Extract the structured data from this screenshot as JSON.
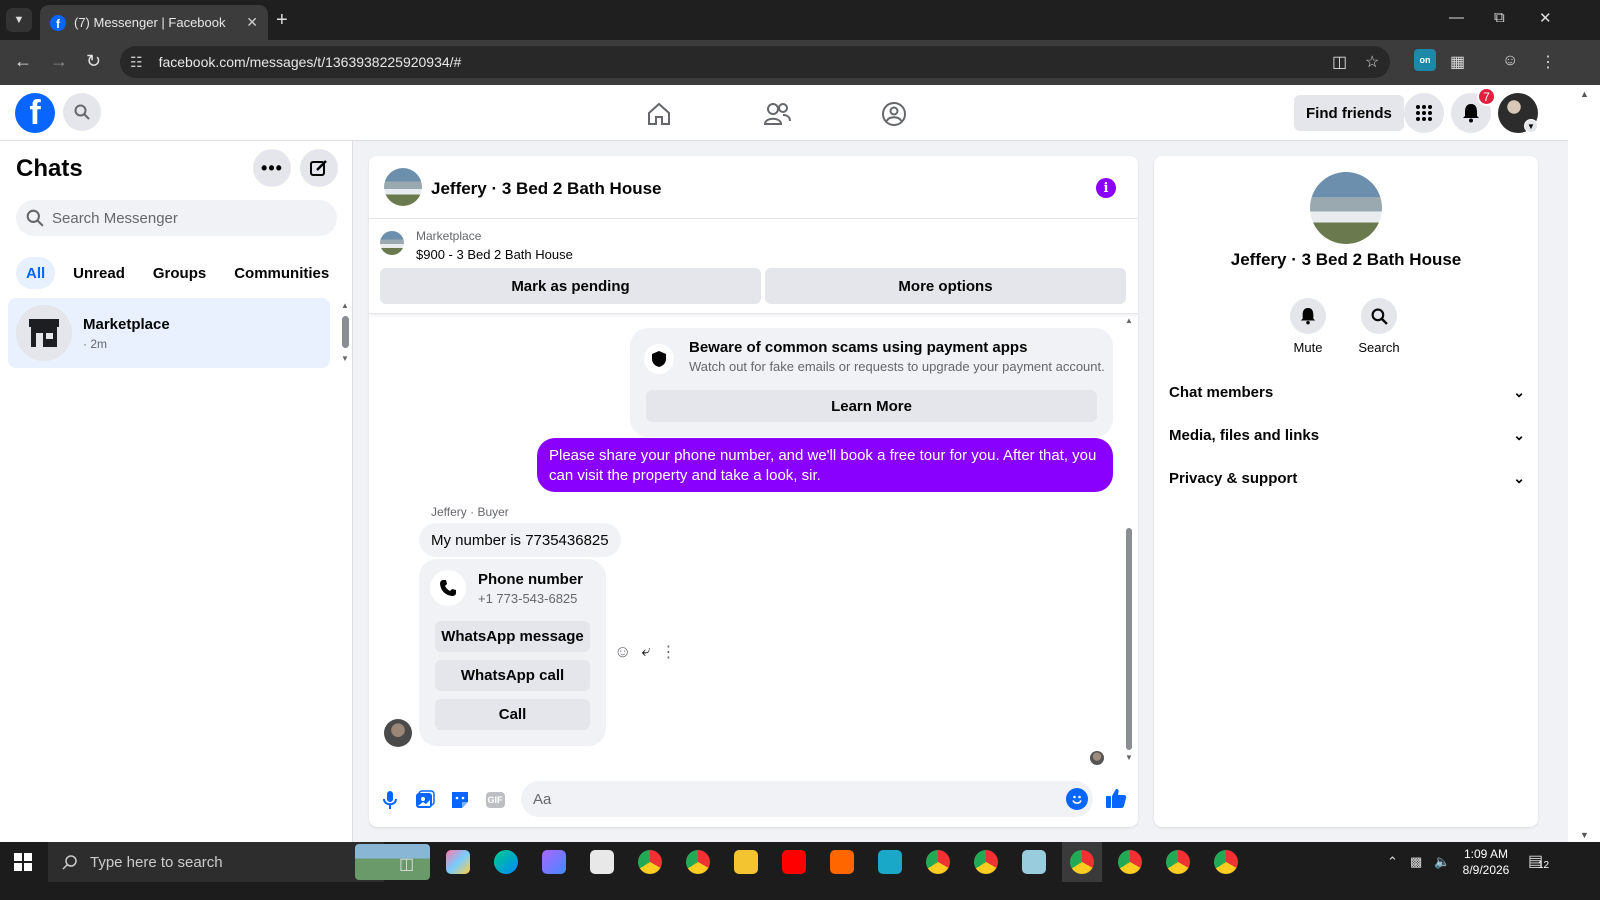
{
  "browser": {
    "tab_title": "(7) Messenger | Facebook",
    "url": "facebook.com/messages/t/1363938225920934/#"
  },
  "header": {
    "find_friends": "Find friends",
    "notification_count": "7"
  },
  "sidebar": {
    "title": "Chats",
    "search_placeholder": "Search Messenger",
    "filters": [
      "All",
      "Unread",
      "Groups",
      "Communities"
    ],
    "active_filter": "All",
    "chats": [
      {
        "name": "Marketplace",
        "time": "· 2m"
      }
    ]
  },
  "conversation": {
    "title": "Jeffery · 3 Bed 2 Bath House",
    "marketplace": {
      "label": "Marketplace",
      "listing": "$900 - 3 Bed 2 Bath House",
      "mark_pending": "Mark as pending",
      "more_options": "More options"
    },
    "scam_notice": {
      "title": "Beware of common scams using payment apps",
      "subtitle": "Watch out for fake emails or requests to upgrade your payment account.",
      "button": "Learn More"
    },
    "outgoing_message": "Please share your phone number, and we'll book a free tour for you. After that, you can visit the property and take a look, sir.",
    "sender_label": "Jeffery · Buyer",
    "incoming_message": "My number is 7735436825",
    "phone_card": {
      "title": "Phone number",
      "number": "+1 773-543-6825",
      "whatsapp_message": "WhatsApp message",
      "whatsapp_call": "WhatsApp call",
      "call": "Call"
    },
    "composer_placeholder": "Aa",
    "accent_color": "#8a00ff"
  },
  "info_panel": {
    "name": "Jeffery · 3 Bed 2 Bath House",
    "mute": "Mute",
    "search": "Search",
    "sections": [
      "Chat members",
      "Media, files and links",
      "Privacy & support"
    ]
  },
  "taskbar": {
    "search_placeholder": "Type here to search",
    "time": "1:09 AM",
    "date": "8/9/2026",
    "notification_count": "12"
  }
}
